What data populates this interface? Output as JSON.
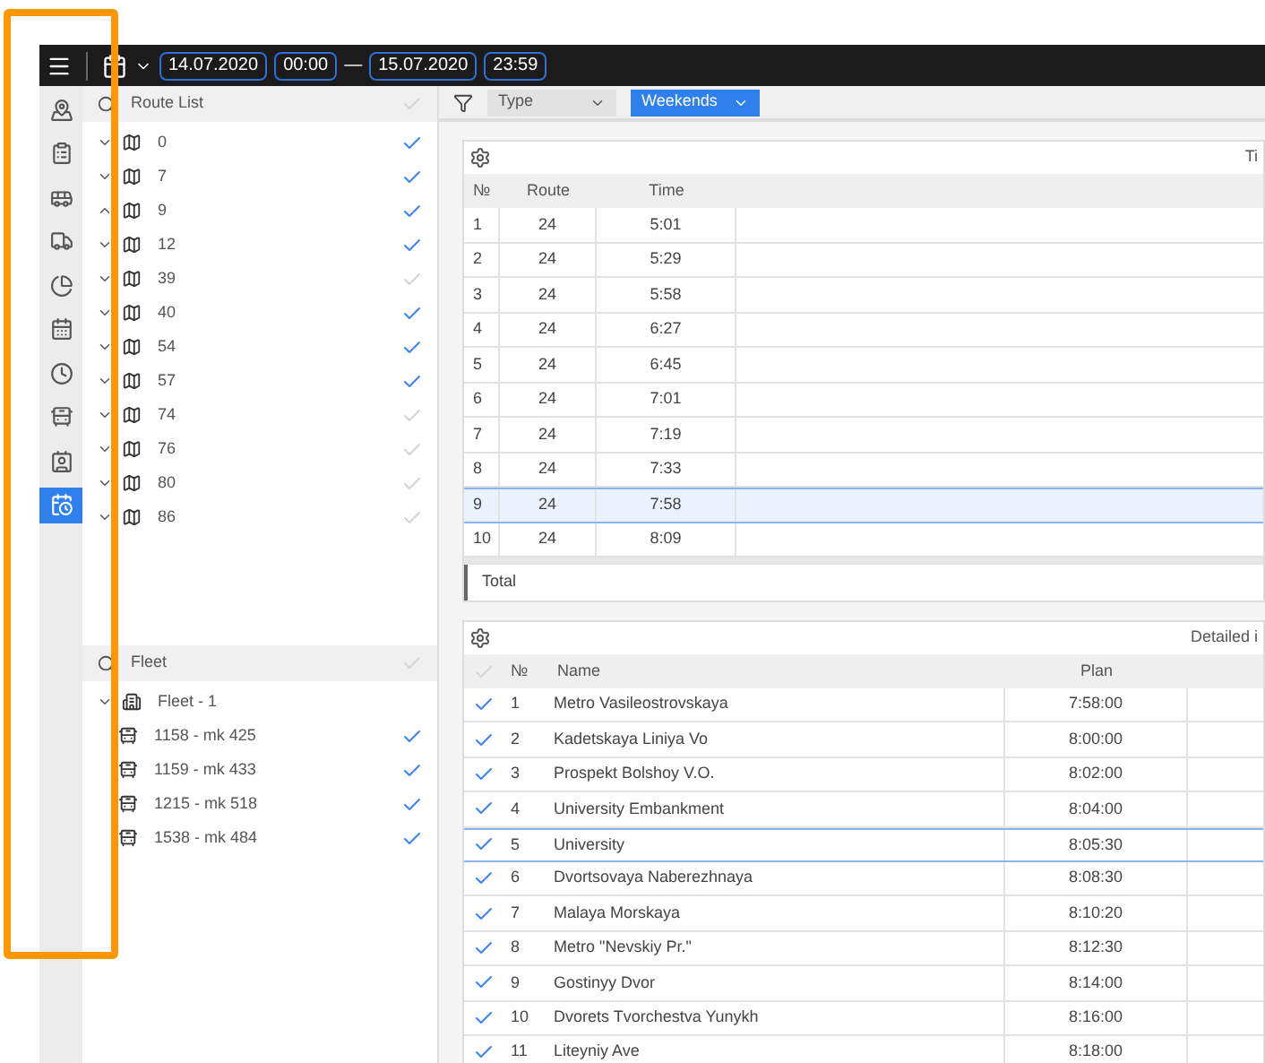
{
  "toolbar": {
    "start_date": "14.07.2020",
    "start_time": "00:00",
    "separator": "—",
    "end_date": "15.07.2020",
    "end_time": "23:59"
  },
  "nav": [
    {
      "kind": "map",
      "selected": false
    },
    {
      "kind": "clipboard",
      "selected": false
    },
    {
      "kind": "bus-stop",
      "selected": false
    },
    {
      "kind": "truck",
      "selected": false
    },
    {
      "kind": "pie",
      "selected": false
    },
    {
      "kind": "calendar",
      "selected": false
    },
    {
      "kind": "clock24",
      "selected": false
    },
    {
      "kind": "bus-clock",
      "selected": false
    },
    {
      "kind": "contact",
      "selected": false
    },
    {
      "kind": "schedule",
      "selected": true
    }
  ],
  "route_list": {
    "title": "Route List",
    "checked": false,
    "items": [
      {
        "label": "0",
        "expanded": false,
        "checked": true
      },
      {
        "label": "7",
        "expanded": false,
        "checked": true
      },
      {
        "label": "9",
        "expanded": true,
        "checked": true
      },
      {
        "label": "12",
        "expanded": false,
        "checked": true
      },
      {
        "label": "39",
        "expanded": false,
        "checked": false
      },
      {
        "label": "40",
        "expanded": false,
        "checked": true
      },
      {
        "label": "54",
        "expanded": false,
        "checked": true
      },
      {
        "label": "57",
        "expanded": false,
        "checked": true
      },
      {
        "label": "74",
        "expanded": false,
        "checked": false
      },
      {
        "label": "76",
        "expanded": false,
        "checked": false
      },
      {
        "label": "80",
        "expanded": false,
        "checked": false
      },
      {
        "label": "86",
        "expanded": false,
        "checked": false
      }
    ]
  },
  "fleet": {
    "title": "Fleet",
    "checked": false,
    "groups": [
      {
        "label": "Fleet - 1",
        "expanded": true,
        "children": [
          {
            "label": "1158 - mk 425",
            "checked": true
          },
          {
            "label": "1159 - mk 433",
            "checked": true
          },
          {
            "label": "1215 - mk 518",
            "checked": true
          },
          {
            "label": "1538 - mk 484",
            "checked": true
          }
        ]
      }
    ]
  },
  "filters": [
    {
      "label": "Type",
      "selected": false
    },
    {
      "label": "Weekends",
      "selected": true
    }
  ],
  "trips_table": {
    "title": "Ti",
    "columns": [
      "№",
      "Route",
      "Time"
    ],
    "total_label": "Total",
    "rows": [
      {
        "cells": [
          "1",
          "24",
          "5:01"
        ],
        "selected": false
      },
      {
        "cells": [
          "2",
          "24",
          "5:29"
        ],
        "selected": false
      },
      {
        "cells": [
          "3",
          "24",
          "5:58"
        ],
        "selected": false
      },
      {
        "cells": [
          "4",
          "24",
          "6:27"
        ],
        "selected": false
      },
      {
        "cells": [
          "5",
          "24",
          "6:45"
        ],
        "selected": false
      },
      {
        "cells": [
          "6",
          "24",
          "7:01"
        ],
        "selected": false
      },
      {
        "cells": [
          "7",
          "24",
          "7:19"
        ],
        "selected": false
      },
      {
        "cells": [
          "8",
          "24",
          "7:33"
        ],
        "selected": false
      },
      {
        "cells": [
          "9",
          "24",
          "7:58"
        ],
        "selected": true
      },
      {
        "cells": [
          "10",
          "24",
          "8:09"
        ],
        "selected": false
      }
    ]
  },
  "stops_table": {
    "title": "Detailed i",
    "checked": false,
    "columns": [
      "№",
      "Name",
      "Plan"
    ],
    "rows": [
      {
        "checked": true,
        "selected": false,
        "cells": [
          "1",
          "Metro Vasileostrovskaya",
          "7:58:00"
        ]
      },
      {
        "checked": true,
        "selected": false,
        "cells": [
          "2",
          "Kadetskaya Liniya Vo",
          "8:00:00"
        ]
      },
      {
        "checked": true,
        "selected": false,
        "cells": [
          "3",
          "Prospekt Bolshoy V.O.",
          "8:02:00"
        ]
      },
      {
        "checked": true,
        "selected": false,
        "cells": [
          "4",
          "University Embankment",
          "8:04:00"
        ]
      },
      {
        "checked": true,
        "selected": true,
        "cells": [
          "5",
          "University",
          "8:05:30"
        ]
      },
      {
        "checked": true,
        "selected": false,
        "cells": [
          "6",
          "Dvortsovaya Naberezhnaya",
          "8:08:30"
        ]
      },
      {
        "checked": true,
        "selected": false,
        "cells": [
          "7",
          "Malaya Morskaya",
          "8:10:20"
        ]
      },
      {
        "checked": true,
        "selected": false,
        "cells": [
          "8",
          "Metro \"Nevskiy Pr.\"",
          "8:12:30"
        ]
      },
      {
        "checked": true,
        "selected": false,
        "cells": [
          "9",
          "Gostinyy Dvor",
          "8:14:00"
        ]
      },
      {
        "checked": true,
        "selected": false,
        "cells": [
          "10",
          "Dvorets Tvorchestva Yunykh",
          "8:16:00"
        ]
      },
      {
        "checked": true,
        "selected": false,
        "cells": [
          "11",
          "Liteyniy Ave",
          "8:18:00"
        ]
      }
    ]
  }
}
